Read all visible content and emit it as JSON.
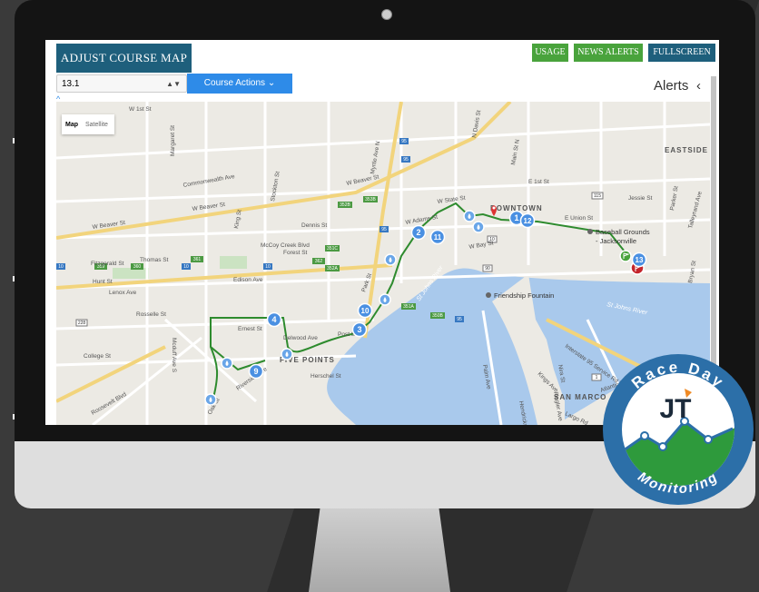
{
  "header": {
    "title": "ADJUST COURSE MAP",
    "buttons": [
      {
        "label": "USAGE"
      },
      {
        "label": "NEWS ALERTS"
      },
      {
        "label": "FULLSCREEN"
      }
    ]
  },
  "controls": {
    "distance_value": "13.1",
    "course_actions_label": "Course Actions",
    "course_actions_caret": "⌄",
    "collapse_caret": "^"
  },
  "alerts": {
    "label": "Alerts",
    "toggle": "‹"
  },
  "map": {
    "type_control": {
      "map": "Map",
      "satellite": "Satellite"
    },
    "areas": [
      "DOWNTOWN",
      "FIVE POINTS",
      "SAN MARCO",
      "EASTSIDE"
    ],
    "pois": [
      "Baseball Grounds",
      "- Jacksonville",
      "Friendship Fountain"
    ],
    "river_labels": [
      "St Johns River",
      "St Johns River"
    ],
    "streets": [
      "W Beaver St",
      "W Beaver St",
      "W Beaver St",
      "W State St",
      "W Bay St",
      "W Adams St",
      "Dennis St",
      "Forest St",
      "Edison Ave",
      "Rosselle St",
      "Ernest St",
      "Delwood Ave",
      "Lenox Ave",
      "Commonwealth Ave",
      "Hunt St",
      "College St",
      "Herschel St",
      "Riverside Ave",
      "Roosevelt Blvd",
      "Interstate 95 Service Rd",
      "Atlantic Blvd",
      "Fitzgerald St",
      "Thomas St",
      "McCoy Creek Blvd",
      "E Union St",
      "E 1st St",
      "W 1st St",
      "Main St N",
      "Jessie St",
      "Parker St",
      "Talleyrand Ave",
      "Bryan St",
      "N Davis St",
      "Margaret St",
      "King St",
      "Stockton St",
      "Myrtle Ave N",
      "Park St",
      "Post St",
      "Palm Ave",
      "Hendricks Ave",
      "Kings Ave",
      "Flagler Ave",
      "Nira St",
      "Largo Rd",
      "Oak St",
      "Mcduff Ave S"
    ],
    "route_markers": [
      "1",
      "12",
      "2",
      "11",
      "3",
      "10",
      "4",
      "9",
      "13"
    ],
    "highway_shields": [
      "10",
      "10",
      "10",
      "95",
      "95",
      "95",
      "95",
      "115",
      "10",
      "1",
      "90",
      "228",
      "359",
      "360",
      "361",
      "362",
      "351A",
      "350B",
      "351C",
      "352A",
      "352B",
      "353B"
    ]
  },
  "logo": {
    "top_text": "Race Day",
    "bottom_text": "Monitoring",
    "mark": "JT"
  },
  "colors": {
    "accent_blue": "#1e5f7c",
    "button_green": "#49a33c",
    "action_blue": "#2e8be8",
    "route": "#2e8b2e",
    "water": "#a9c9ec",
    "marker": "#4a90e2"
  }
}
